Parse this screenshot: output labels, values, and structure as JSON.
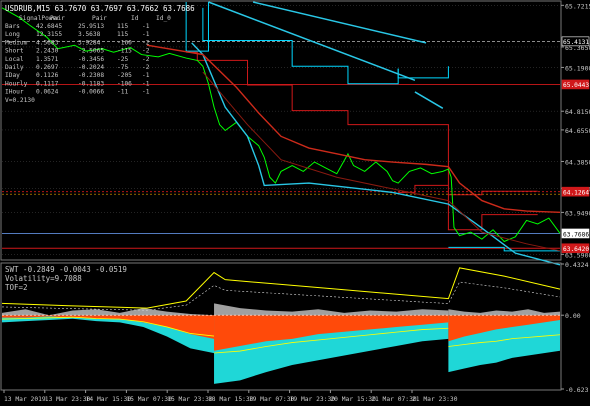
{
  "colors": {
    "background": "#000000",
    "grid": "#3a3a3a",
    "axis_text": "#c8c8c8",
    "price": "#00ff00",
    "channel": "#29c7e6",
    "upper_band": "#cc2a1a",
    "level_red": "#d0181a",
    "level_cyan": "#00d8ff",
    "info_text": "#c8c8c8",
    "swt_fill": "#1fd7d7",
    "swt_orange": "#ff4a0a",
    "swt_gray": "#a0a0a0",
    "swt_line": "#ffff00"
  },
  "main_panel": {
    "header": "USDRUB,M15  63.7670 63.7697 63.7662 63.7686",
    "info_table": {
      "columns": [
        "SignalPower",
        "Pair",
        "Pair",
        "Id",
        "Id_0"
      ],
      "rows": [
        [
          "Bars",
          "42.6845",
          "25.9513",
          "115",
          "-1"
        ],
        [
          "Long",
          "12.3155",
          "3.5638",
          "115",
          "-1"
        ],
        [
          "Medium",
          "4.5683",
          "3.9284",
          "-160",
          "-2"
        ],
        [
          "Short",
          "2.2430",
          "-2.5065",
          "-115",
          "-2"
        ],
        [
          "Local",
          "1.3571",
          "-0.3456",
          "-25",
          "-2"
        ],
        [
          "Daily",
          "0.2697",
          "-0.2024",
          "-75",
          "-2"
        ],
        [
          "IDay",
          "0.1126",
          "-0.2308",
          "-205",
          "-1"
        ],
        [
          "Hourly",
          "0.1117",
          "-0.1183",
          "-106",
          "-1"
        ],
        [
          "IHour",
          "0.0624",
          "-0.0066",
          "-11",
          "-1"
        ]
      ],
      "footer": "V=0.2130"
    },
    "price_ticks": [
      "65.7215",
      "65.3650",
      "65.1900",
      "64.8150",
      "64.6550",
      "64.3850",
      "64.1550",
      "63.9490",
      "63.5900"
    ],
    "badges": [
      {
        "text": "65.4131",
        "color": "#ffffff",
        "bg": "#000000",
        "price": 65.4131
      },
      {
        "text": "65.0443",
        "color": "#ffffff",
        "bg": "#d0181a",
        "price": 65.0443
      },
      {
        "text": "64.1264",
        "color": "#ffffff",
        "bg": "#d0181a",
        "price": 64.1264
      },
      {
        "text": "63.7686",
        "color": "#000000",
        "bg": "#ffffff",
        "price": 63.7686
      },
      {
        "text": "63.6420",
        "color": "#ffffff",
        "bg": "#d0181a",
        "price": 63.642
      }
    ]
  },
  "sub_panel": {
    "header": "SWT -0.2849 -0.0043 -0.0519",
    "line2": "Volatility=9.7088",
    "line3": "TOF=2",
    "ticks": [
      "0.4324",
      "0.00",
      "-0.623"
    ]
  },
  "x_ticks": [
    "13 Mar 2019",
    "13 Mar 23:30",
    "14 Mar 15:30",
    "15 Mar 07:30",
    "15 Mar 23:30",
    "18 Mar 15:30",
    "19 Mar 07:30",
    "19 Mar 23:30",
    "20 Mar 15:30",
    "21 Mar 07:30",
    "21 Mar 23:30"
  ],
  "chart_data": [
    {
      "type": "line",
      "symbol": "USDRUB",
      "timeframe": "M15",
      "ylim": [
        63.55,
        65.75
      ],
      "y_ticks": [
        65.7215,
        65.365,
        65.19,
        64.815,
        64.655,
        64.385,
        64.155,
        63.949,
        63.59
      ],
      "x_tick_labels": [
        "13 Mar 2019",
        "13 Mar 23:30",
        "14 Mar 15:30",
        "15 Mar 07:30",
        "15 Mar 23:30",
        "18 Mar 15:30",
        "19 Mar 07:30",
        "19 Mar 23:30",
        "20 Mar 15:30",
        "21 Mar 07:30",
        "21 Mar 23:30"
      ],
      "series": [
        {
          "role": "price",
          "color": "#00ff00",
          "points": [
            [
              0,
              65.7
            ],
            [
              0.03,
              65.62
            ],
            [
              0.05,
              65.55
            ],
            [
              0.08,
              65.45
            ],
            [
              0.1,
              65.35
            ],
            [
              0.13,
              65.38
            ],
            [
              0.15,
              65.33
            ],
            [
              0.18,
              65.35
            ],
            [
              0.2,
              65.32
            ],
            [
              0.23,
              65.36
            ],
            [
              0.25,
              65.3
            ],
            [
              0.28,
              65.28
            ],
            [
              0.3,
              65.31
            ],
            [
              0.33,
              65.27
            ],
            [
              0.35,
              65.25
            ],
            [
              0.36,
              65.2
            ],
            [
              0.37,
              65.05
            ],
            [
              0.38,
              64.85
            ],
            [
              0.39,
              64.7
            ],
            [
              0.4,
              64.65
            ],
            [
              0.42,
              64.72
            ],
            [
              0.44,
              64.6
            ],
            [
              0.46,
              64.52
            ],
            [
              0.47,
              64.42
            ],
            [
              0.48,
              64.25
            ],
            [
              0.49,
              64.2
            ],
            [
              0.5,
              64.3
            ],
            [
              0.52,
              64.35
            ],
            [
              0.54,
              64.3
            ],
            [
              0.56,
              64.38
            ],
            [
              0.58,
              64.33
            ],
            [
              0.6,
              64.28
            ],
            [
              0.62,
              64.45
            ],
            [
              0.63,
              64.35
            ],
            [
              0.65,
              64.3
            ],
            [
              0.67,
              64.38
            ],
            [
              0.69,
              64.3
            ],
            [
              0.7,
              64.22
            ],
            [
              0.71,
              64.2
            ],
            [
              0.73,
              64.3
            ],
            [
              0.75,
              64.33
            ],
            [
              0.77,
              64.28
            ],
            [
              0.79,
              64.3
            ],
            [
              0.8,
              64.32
            ],
            [
              0.805,
              64.25
            ],
            [
              0.81,
              63.82
            ],
            [
              0.82,
              63.75
            ],
            [
              0.84,
              63.78
            ],
            [
              0.86,
              63.72
            ],
            [
              0.88,
              63.8
            ],
            [
              0.9,
              63.7
            ],
            [
              0.92,
              63.74
            ],
            [
              0.94,
              63.88
            ],
            [
              0.96,
              63.85
            ],
            [
              0.98,
              63.9
            ],
            [
              1.0,
              63.77
            ]
          ]
        },
        {
          "role": "channel",
          "color": "#29c7e6",
          "points": [
            [
              0.34,
              65.4
            ],
            [
              0.36,
              65.3
            ],
            [
              0.4,
              64.85
            ],
            [
              0.44,
              64.6
            ],
            [
              0.46,
              64.35
            ],
            [
              0.47,
              64.18
            ],
            [
              0.55,
              64.2
            ],
            [
              0.7,
              64.12
            ],
            [
              0.8,
              64.02
            ],
            [
              0.85,
              63.85
            ],
            [
              0.92,
              63.6
            ],
            [
              1.0,
              63.5
            ]
          ]
        },
        {
          "role": "upper_band",
          "color": "#cc2a1a",
          "points": [
            [
              0.26,
              65.38
            ],
            [
              0.36,
              65.3
            ],
            [
              0.42,
              65.02
            ],
            [
              0.46,
              64.8
            ],
            [
              0.5,
              64.6
            ],
            [
              0.55,
              64.5
            ],
            [
              0.6,
              64.45
            ],
            [
              0.65,
              64.4
            ],
            [
              0.7,
              64.38
            ],
            [
              0.76,
              64.36
            ],
            [
              0.8,
              64.34
            ],
            [
              0.82,
              64.2
            ],
            [
              0.86,
              64.05
            ],
            [
              0.9,
              63.98
            ],
            [
              0.94,
              63.96
            ],
            [
              1.0,
              63.95
            ]
          ]
        }
      ]
    },
    {
      "type": "area",
      "name": "SWT",
      "header_values": [
        -0.2849,
        -0.0043,
        -0.0519
      ],
      "volatility": 9.7088,
      "tof": 2,
      "ylim": [
        -0.623,
        0.4324
      ],
      "y_ticks": [
        0.4324,
        0.0,
        -0.623
      ],
      "segments": [
        {
          "x": [
            0.0,
            0.38
          ],
          "upper": [
            0.02,
            0.05,
            0.0,
            0.04,
            0.05,
            0.02,
            0.06,
            0.03,
            0.01,
            0.0
          ],
          "lower": [
            -0.06,
            -0.05,
            -0.04,
            -0.03,
            -0.05,
            -0.06,
            -0.1,
            -0.18,
            -0.28,
            -0.32
          ],
          "mid": [
            -0.02,
            -0.02,
            -0.01,
            -0.02,
            -0.03,
            -0.03,
            -0.06,
            -0.1,
            -0.16,
            -0.2
          ]
        },
        {
          "x": [
            0.38,
            0.8
          ],
          "upper": [
            0.1,
            0.06,
            0.04,
            0.03,
            0.05,
            0.02,
            0.04,
            0.03,
            0.05,
            0.04
          ],
          "lower": [
            -0.58,
            -0.55,
            -0.48,
            -0.42,
            -0.38,
            -0.34,
            -0.3,
            -0.26,
            -0.22,
            -0.2
          ],
          "mid": [
            -0.3,
            -0.26,
            -0.22,
            -0.2,
            -0.16,
            -0.14,
            -0.12,
            -0.1,
            -0.08,
            -0.06
          ]
        },
        {
          "x": [
            0.8,
            1.0
          ],
          "upper": [
            0.05,
            0.03,
            0.02,
            0.04,
            0.03,
            0.05,
            0.02,
            0.03
          ],
          "lower": [
            -0.48,
            -0.45,
            -0.42,
            -0.4,
            -0.36,
            -0.34,
            -0.32,
            -0.3
          ],
          "mid": [
            -0.22,
            -0.18,
            -0.15,
            -0.12,
            -0.1,
            -0.08,
            -0.06,
            -0.04
          ]
        }
      ],
      "envelope": [
        [
          0.0,
          0.1
        ],
        [
          0.12,
          0.08
        ],
        [
          0.26,
          0.06
        ],
        [
          0.33,
          0.12
        ],
        [
          0.38,
          0.36
        ],
        [
          0.4,
          0.3
        ],
        [
          0.5,
          0.26
        ],
        [
          0.6,
          0.22
        ],
        [
          0.7,
          0.18
        ],
        [
          0.8,
          0.14
        ],
        [
          0.82,
          0.4
        ],
        [
          0.9,
          0.33
        ],
        [
          1.0,
          0.22
        ]
      ]
    }
  ]
}
